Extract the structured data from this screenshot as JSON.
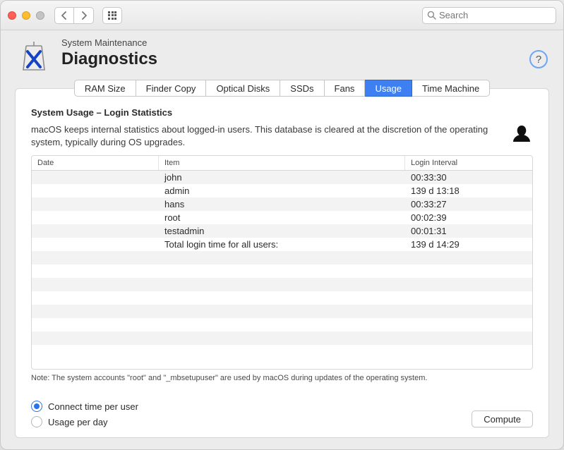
{
  "search": {
    "placeholder": "Search"
  },
  "header": {
    "subtitle": "System Maintenance",
    "title": "Diagnostics"
  },
  "tabs": [
    {
      "label": "RAM Size",
      "active": false
    },
    {
      "label": "Finder Copy",
      "active": false
    },
    {
      "label": "Optical Disks",
      "active": false
    },
    {
      "label": "SSDs",
      "active": false
    },
    {
      "label": "Fans",
      "active": false
    },
    {
      "label": "Usage",
      "active": true
    },
    {
      "label": "Time Machine",
      "active": false
    }
  ],
  "section": {
    "title": "System Usage – Login Statistics",
    "description": "macOS keeps internal statistics about logged-in users. This database is cleared at the discretion of the operating system, typically during OS upgrades."
  },
  "table": {
    "columns": {
      "date": "Date",
      "item": "Item",
      "interval": "Login Interval"
    },
    "rows": [
      {
        "date": "",
        "item": "john",
        "interval": "00:33:30"
      },
      {
        "date": "",
        "item": "admin",
        "interval": "139 d 13:18"
      },
      {
        "date": "",
        "item": "hans",
        "interval": "00:33:27"
      },
      {
        "date": "",
        "item": "root",
        "interval": "00:02:39"
      },
      {
        "date": "",
        "item": "testadmin",
        "interval": "00:01:31"
      },
      {
        "date": "",
        "item": "Total login time for all users:",
        "interval": "139 d 14:29"
      }
    ]
  },
  "note": "Note: The system accounts \"root\" and \"_mbsetupuser\" are used by macOS during updates of the operating system.",
  "options": {
    "connect_per_user": "Connect time per user",
    "usage_per_day": "Usage per day",
    "selected": "connect_per_user"
  },
  "buttons": {
    "compute": "Compute",
    "help": "?"
  }
}
